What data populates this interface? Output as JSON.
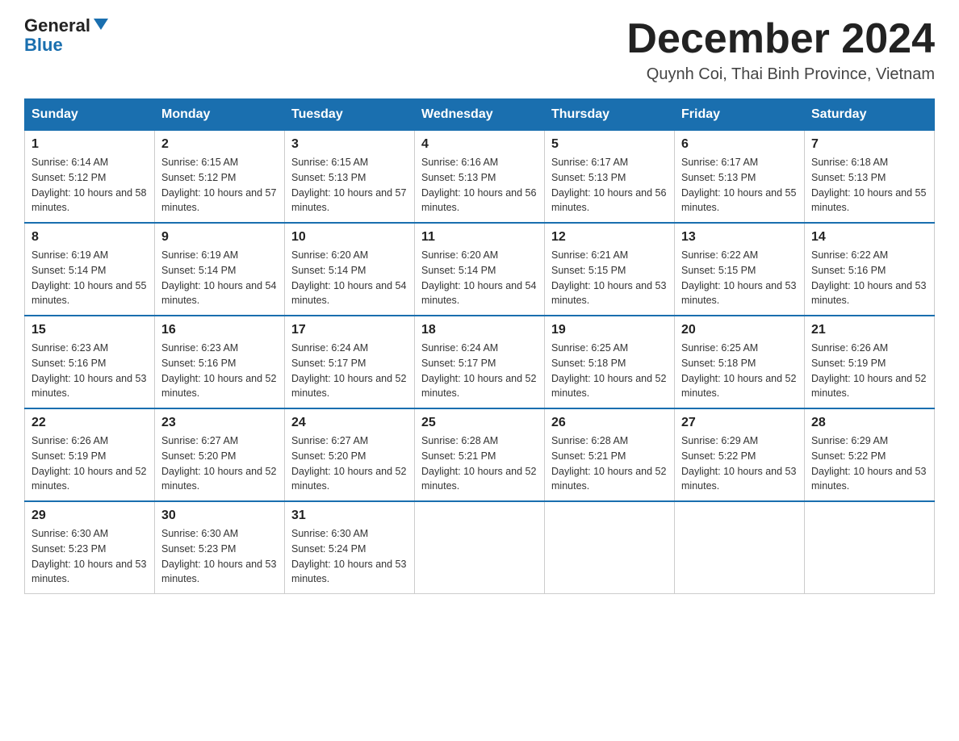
{
  "logo": {
    "text_general": "General",
    "text_blue": "Blue"
  },
  "header": {
    "month_year": "December 2024",
    "location": "Quynh Coi, Thai Binh Province, Vietnam"
  },
  "days_of_week": [
    "Sunday",
    "Monday",
    "Tuesday",
    "Wednesday",
    "Thursday",
    "Friday",
    "Saturday"
  ],
  "weeks": [
    [
      {
        "day": "1",
        "sunrise": "6:14 AM",
        "sunset": "5:12 PM",
        "daylight": "10 hours and 58 minutes."
      },
      {
        "day": "2",
        "sunrise": "6:15 AM",
        "sunset": "5:12 PM",
        "daylight": "10 hours and 57 minutes."
      },
      {
        "day": "3",
        "sunrise": "6:15 AM",
        "sunset": "5:13 PM",
        "daylight": "10 hours and 57 minutes."
      },
      {
        "day": "4",
        "sunrise": "6:16 AM",
        "sunset": "5:13 PM",
        "daylight": "10 hours and 56 minutes."
      },
      {
        "day": "5",
        "sunrise": "6:17 AM",
        "sunset": "5:13 PM",
        "daylight": "10 hours and 56 minutes."
      },
      {
        "day": "6",
        "sunrise": "6:17 AM",
        "sunset": "5:13 PM",
        "daylight": "10 hours and 55 minutes."
      },
      {
        "day": "7",
        "sunrise": "6:18 AM",
        "sunset": "5:13 PM",
        "daylight": "10 hours and 55 minutes."
      }
    ],
    [
      {
        "day": "8",
        "sunrise": "6:19 AM",
        "sunset": "5:14 PM",
        "daylight": "10 hours and 55 minutes."
      },
      {
        "day": "9",
        "sunrise": "6:19 AM",
        "sunset": "5:14 PM",
        "daylight": "10 hours and 54 minutes."
      },
      {
        "day": "10",
        "sunrise": "6:20 AM",
        "sunset": "5:14 PM",
        "daylight": "10 hours and 54 minutes."
      },
      {
        "day": "11",
        "sunrise": "6:20 AM",
        "sunset": "5:14 PM",
        "daylight": "10 hours and 54 minutes."
      },
      {
        "day": "12",
        "sunrise": "6:21 AM",
        "sunset": "5:15 PM",
        "daylight": "10 hours and 53 minutes."
      },
      {
        "day": "13",
        "sunrise": "6:22 AM",
        "sunset": "5:15 PM",
        "daylight": "10 hours and 53 minutes."
      },
      {
        "day": "14",
        "sunrise": "6:22 AM",
        "sunset": "5:16 PM",
        "daylight": "10 hours and 53 minutes."
      }
    ],
    [
      {
        "day": "15",
        "sunrise": "6:23 AM",
        "sunset": "5:16 PM",
        "daylight": "10 hours and 53 minutes."
      },
      {
        "day": "16",
        "sunrise": "6:23 AM",
        "sunset": "5:16 PM",
        "daylight": "10 hours and 52 minutes."
      },
      {
        "day": "17",
        "sunrise": "6:24 AM",
        "sunset": "5:17 PM",
        "daylight": "10 hours and 52 minutes."
      },
      {
        "day": "18",
        "sunrise": "6:24 AM",
        "sunset": "5:17 PM",
        "daylight": "10 hours and 52 minutes."
      },
      {
        "day": "19",
        "sunrise": "6:25 AM",
        "sunset": "5:18 PM",
        "daylight": "10 hours and 52 minutes."
      },
      {
        "day": "20",
        "sunrise": "6:25 AM",
        "sunset": "5:18 PM",
        "daylight": "10 hours and 52 minutes."
      },
      {
        "day": "21",
        "sunrise": "6:26 AM",
        "sunset": "5:19 PM",
        "daylight": "10 hours and 52 minutes."
      }
    ],
    [
      {
        "day": "22",
        "sunrise": "6:26 AM",
        "sunset": "5:19 PM",
        "daylight": "10 hours and 52 minutes."
      },
      {
        "day": "23",
        "sunrise": "6:27 AM",
        "sunset": "5:20 PM",
        "daylight": "10 hours and 52 minutes."
      },
      {
        "day": "24",
        "sunrise": "6:27 AM",
        "sunset": "5:20 PM",
        "daylight": "10 hours and 52 minutes."
      },
      {
        "day": "25",
        "sunrise": "6:28 AM",
        "sunset": "5:21 PM",
        "daylight": "10 hours and 52 minutes."
      },
      {
        "day": "26",
        "sunrise": "6:28 AM",
        "sunset": "5:21 PM",
        "daylight": "10 hours and 52 minutes."
      },
      {
        "day": "27",
        "sunrise": "6:29 AM",
        "sunset": "5:22 PM",
        "daylight": "10 hours and 53 minutes."
      },
      {
        "day": "28",
        "sunrise": "6:29 AM",
        "sunset": "5:22 PM",
        "daylight": "10 hours and 53 minutes."
      }
    ],
    [
      {
        "day": "29",
        "sunrise": "6:30 AM",
        "sunset": "5:23 PM",
        "daylight": "10 hours and 53 minutes."
      },
      {
        "day": "30",
        "sunrise": "6:30 AM",
        "sunset": "5:23 PM",
        "daylight": "10 hours and 53 minutes."
      },
      {
        "day": "31",
        "sunrise": "6:30 AM",
        "sunset": "5:24 PM",
        "daylight": "10 hours and 53 minutes."
      },
      null,
      null,
      null,
      null
    ]
  ]
}
